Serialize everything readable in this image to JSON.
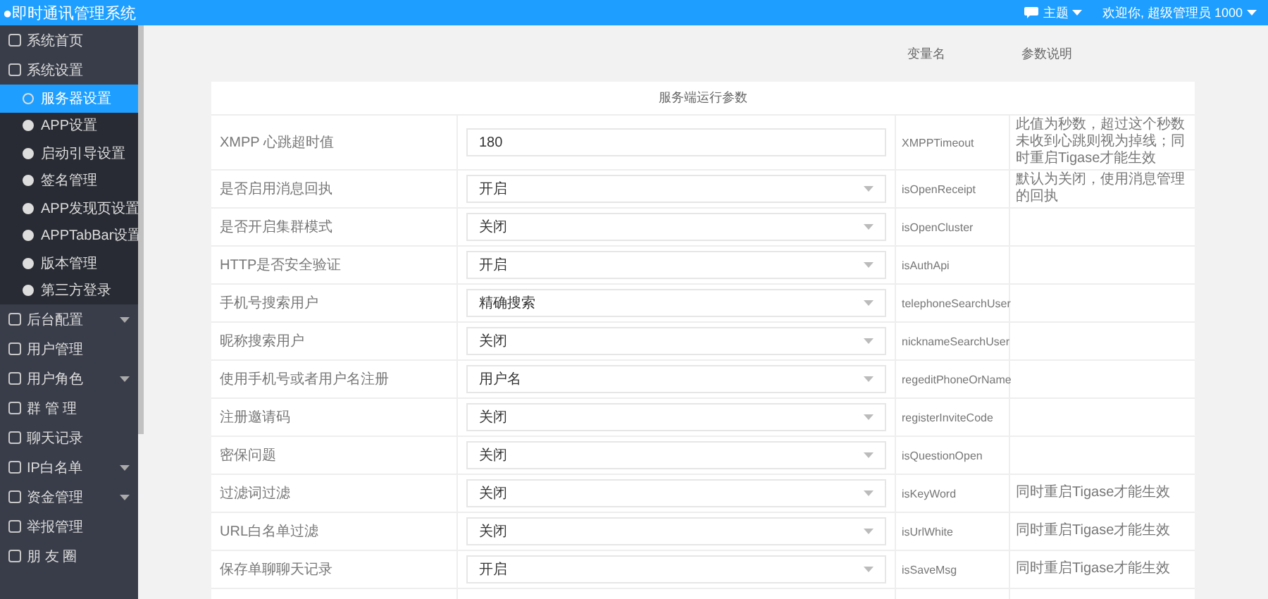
{
  "header": {
    "logo": "●即时通讯管理系统",
    "theme_menu": "主题",
    "user_menu": "欢迎你, 超级管理员 1000"
  },
  "sidebar": {
    "items": [
      {
        "label": "系统首页",
        "kind": "link",
        "selected": false
      },
      {
        "label": "系统设置",
        "kind": "group",
        "expanded": true,
        "selected": false,
        "children": [
          {
            "label": "服务器设置",
            "selected": true
          },
          {
            "label": "APP设置",
            "selected": false
          },
          {
            "label": "启动引导设置",
            "selected": false
          },
          {
            "label": "签名管理",
            "selected": false
          },
          {
            "label": "APP发现页设置",
            "selected": false
          },
          {
            "label": "APPTabBar设置",
            "selected": false
          },
          {
            "label": "版本管理",
            "selected": false
          },
          {
            "label": "第三方登录",
            "selected": false
          }
        ]
      },
      {
        "label": "后台配置",
        "kind": "group",
        "expanded": false,
        "selected": false
      },
      {
        "label": "用户管理",
        "kind": "link",
        "selected": false
      },
      {
        "label": "用户角色",
        "kind": "group",
        "expanded": false,
        "selected": false
      },
      {
        "label": "群 管 理",
        "kind": "link",
        "selected": false
      },
      {
        "label": "聊天记录",
        "kind": "link",
        "selected": false
      },
      {
        "label": "IP白名单",
        "kind": "group",
        "expanded": false,
        "selected": false
      },
      {
        "label": "资金管理",
        "kind": "group",
        "expanded": false,
        "selected": false
      },
      {
        "label": "举报管理",
        "kind": "link",
        "selected": false
      },
      {
        "label": "朋 友 圈",
        "kind": "link",
        "selected": false
      }
    ]
  },
  "table": {
    "columns": {
      "column_3": "变量名",
      "column_4": "参数说明"
    },
    "section_title": "服务端运行参数",
    "rows": [
      {
        "label": "XMPP 心跳超时值",
        "kind": "input",
        "value": "180",
        "variable": "XMPPTimeout",
        "description": "此值为秒数，超过这个秒数未收到心跳则视为掉线；同时重启Tigase才能生效"
      },
      {
        "label": "是否启用消息回执",
        "kind": "select",
        "value": "开启",
        "variable": "isOpenReceipt",
        "description": "默认为关闭，使用消息管理的回执"
      },
      {
        "label": "是否开启集群模式",
        "kind": "select",
        "value": "关闭",
        "variable": "isOpenCluster"
      },
      {
        "label": "HTTP是否安全验证",
        "kind": "select",
        "value": "开启",
        "variable": "isAuthApi"
      },
      {
        "label": "手机号搜索用户",
        "kind": "select",
        "value": "精确搜索",
        "variable": "telephoneSearchUser"
      },
      {
        "label": "昵称搜索用户",
        "kind": "select",
        "value": "关闭",
        "variable": "nicknameSearchUser"
      },
      {
        "label": "使用手机号或者用户名注册",
        "kind": "select",
        "value": "用户名",
        "variable": "regeditPhoneOrName"
      },
      {
        "label": "注册邀请码",
        "kind": "select",
        "value": "关闭",
        "variable": "registerInviteCode"
      },
      {
        "label": "密保问题",
        "kind": "select",
        "value": "关闭",
        "variable": "isQuestionOpen"
      },
      {
        "label": "过滤词过滤",
        "kind": "select",
        "value": "关闭",
        "variable": "isKeyWord",
        "description": "同时重启Tigase才能生效"
      },
      {
        "label": "URL白名单过滤",
        "kind": "select",
        "value": "关闭",
        "variable": "isUrlWhite",
        "description": "同时重启Tigase才能生效"
      },
      {
        "label": "保存单聊聊天记录",
        "kind": "select",
        "value": "开启",
        "variable": "isSaveMsg",
        "description": "同时重启Tigase才能生效"
      }
    ]
  }
}
